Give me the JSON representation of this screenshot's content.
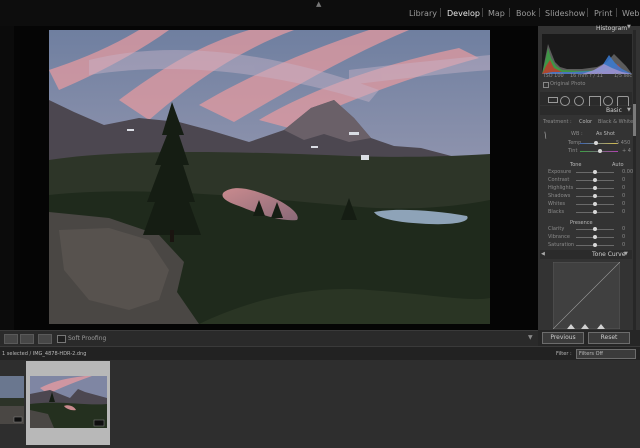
{
  "modules": [
    "Library",
    "Develop",
    "Map",
    "Book",
    "Slideshow",
    "Print",
    "Web"
  ],
  "active_module": "Develop",
  "toolbar": {
    "soft_proofing": "Soft Proofing"
  },
  "panel": {
    "histogram": "Histogram",
    "hist_meta": [
      "ISO 100",
      "16 mm",
      "f / 11",
      "1/5 sec"
    ],
    "original_photo": "Original Photo",
    "basic": "Basic",
    "treatment": "Treatment :",
    "color": "Color",
    "bw": "Black & White",
    "wb": "WB :",
    "as_shot": "As Shot",
    "temp": "Temp",
    "temp_val": "5 450",
    "tint": "Tint",
    "tint_val": "+ 4",
    "tone": "Tone",
    "auto": "Auto",
    "tone_sliders": [
      {
        "label": "Exposure",
        "value": "0.00",
        "pos": 0.5
      },
      {
        "label": "Contrast",
        "value": "0",
        "pos": 0.5
      },
      {
        "label": "Highlights",
        "value": "0",
        "pos": 0.5
      },
      {
        "label": "Shadows",
        "value": "0",
        "pos": 0.5
      },
      {
        "label": "Whites",
        "value": "0",
        "pos": 0.5
      },
      {
        "label": "Blacks",
        "value": "0",
        "pos": 0.5
      }
    ],
    "presence": "Presence",
    "presence_sliders": [
      {
        "label": "Clarity",
        "value": "0",
        "pos": 0.5
      },
      {
        "label": "Vibrance",
        "value": "0",
        "pos": 0.5
      },
      {
        "label": "Saturation",
        "value": "0",
        "pos": 0.5
      }
    ],
    "tone_curve": "Tone Curve",
    "previous": "Previous",
    "reset": "Reset"
  },
  "filmstrip": {
    "info": "1 selected / IMG_4878-HDR-2.dng",
    "filter_label": "Filter :",
    "filter_value": "Filters Off"
  },
  "colors": {
    "accent": "#e8e8e8",
    "panel": "#333333",
    "background": "#1e1e1e"
  }
}
